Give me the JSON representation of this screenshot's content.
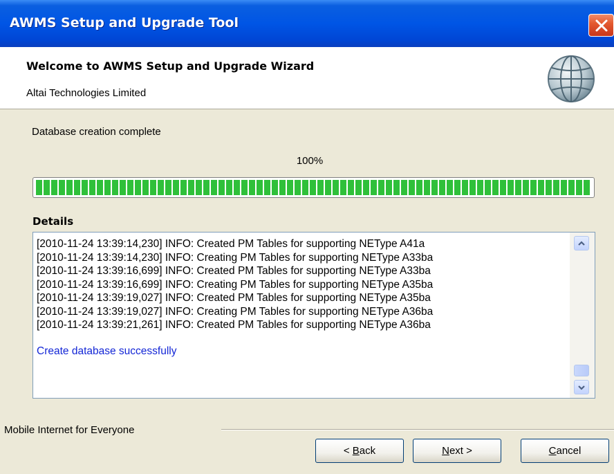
{
  "window": {
    "title": "AWMS Setup and Upgrade Tool"
  },
  "header": {
    "title": "Welcome to AWMS Setup and Upgrade Wizard",
    "subtitle": "Altai Technologies Limited"
  },
  "status": {
    "text": "Database creation complete",
    "progress_label": "100%",
    "progress_value": 1.0
  },
  "details": {
    "label": "Details",
    "lines": [
      "[2010-11-24 13:39:14,230]  INFO: Created PM Tables for supporting NEType A41a",
      "[2010-11-24 13:39:14,230]  INFO: Creating PM Tables for supporting NEType A33ba",
      "[2010-11-24 13:39:16,699]  INFO: Created PM Tables for supporting NEType A33ba",
      "[2010-11-24 13:39:16,699]  INFO: Creating PM Tables for supporting NEType A35ba",
      "[2010-11-24 13:39:19,027]  INFO: Created PM Tables for supporting NEType A35ba",
      "[2010-11-24 13:39:19,027]  INFO: Creating PM Tables for supporting NEType A36ba",
      "[2010-11-24 13:39:21,261]  INFO: Created PM Tables for supporting NEType A36ba"
    ],
    "success": "Create database successfully"
  },
  "footer": {
    "text": "Mobile Internet for Everyone"
  },
  "buttons": {
    "back": {
      "pre": "< ",
      "key": "B",
      "rest": "ack"
    },
    "next": {
      "key": "N",
      "rest": "ext >"
    },
    "cancel": {
      "key": "C",
      "rest": "ancel"
    }
  },
  "colors": {
    "title_bar": "#0055E5",
    "dialog_bg": "#ECE9D8",
    "progress_fill": "#2FC03A",
    "success_text": "#1326D6"
  },
  "icons": {
    "close": "close-icon",
    "globe": "globe-icon",
    "scroll_up": "chevron-up-icon",
    "scroll_down": "chevron-down-icon"
  }
}
